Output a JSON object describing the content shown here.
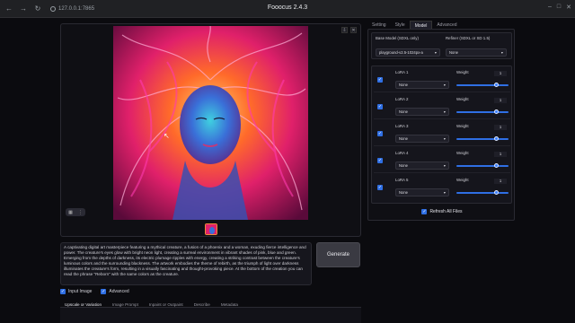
{
  "browser": {
    "url": "127.0.0.1:7865",
    "title": "Fooocus 2.4.3"
  },
  "gallery": {
    "thumb_count": 1
  },
  "prompt": {
    "text": "A captivating digital art masterpiece featuring a mythical creature, a fusion of a phoenix and a woman, exuding fierce intelligence and power. The creature's eyes glow with bright neon light, creating a surreal environment in vibrant shades of pink, blue and green. Emerging from the depths of darkness, its electric plumage ripples with energy, creating a striking contrast between the creature's luminous colors and the surrounding blackness. The artwork embodies the theme of rebirth, as the triumph of light over darkness illuminates the creature's form, resulting in a visually fascinating and thought-provoking piece. At the bottom of the creation you can read the phrase \"Reborn\" with the same colors as the creature."
  },
  "generate_label": "Generate",
  "options": {
    "input_image": "Input Image",
    "advanced": "Advanced"
  },
  "bottom_tabs": [
    "Upscale or Variation",
    "Image Prompt",
    "Inpaint or Outpaint",
    "Describe",
    "Metadata"
  ],
  "right_tabs": [
    "Setting",
    "Style",
    "Model",
    "Advanced"
  ],
  "model": {
    "base_label": "Base Model (SDXL only)",
    "base_value": "playground-v2.5-1024px-a",
    "refiner_label": "Refiner (SDXL or SD 1.5)",
    "refiner_value": "None"
  },
  "loras": [
    {
      "label": "LoRA 1",
      "value": "None",
      "weight_label": "Weight",
      "weight": "1"
    },
    {
      "label": "LoRA 2",
      "value": "None",
      "weight_label": "Weight",
      "weight": "1"
    },
    {
      "label": "LoRA 3",
      "value": "None",
      "weight_label": "Weight",
      "weight": "1"
    },
    {
      "label": "LoRA 4",
      "value": "None",
      "weight_label": "Weight",
      "weight": "1"
    },
    {
      "label": "LoRA 5",
      "value": "None",
      "weight_label": "Weight",
      "weight": "1"
    }
  ],
  "refresh_label": "Refresh All Files",
  "colors": {
    "accent": "#2f6fe4"
  }
}
